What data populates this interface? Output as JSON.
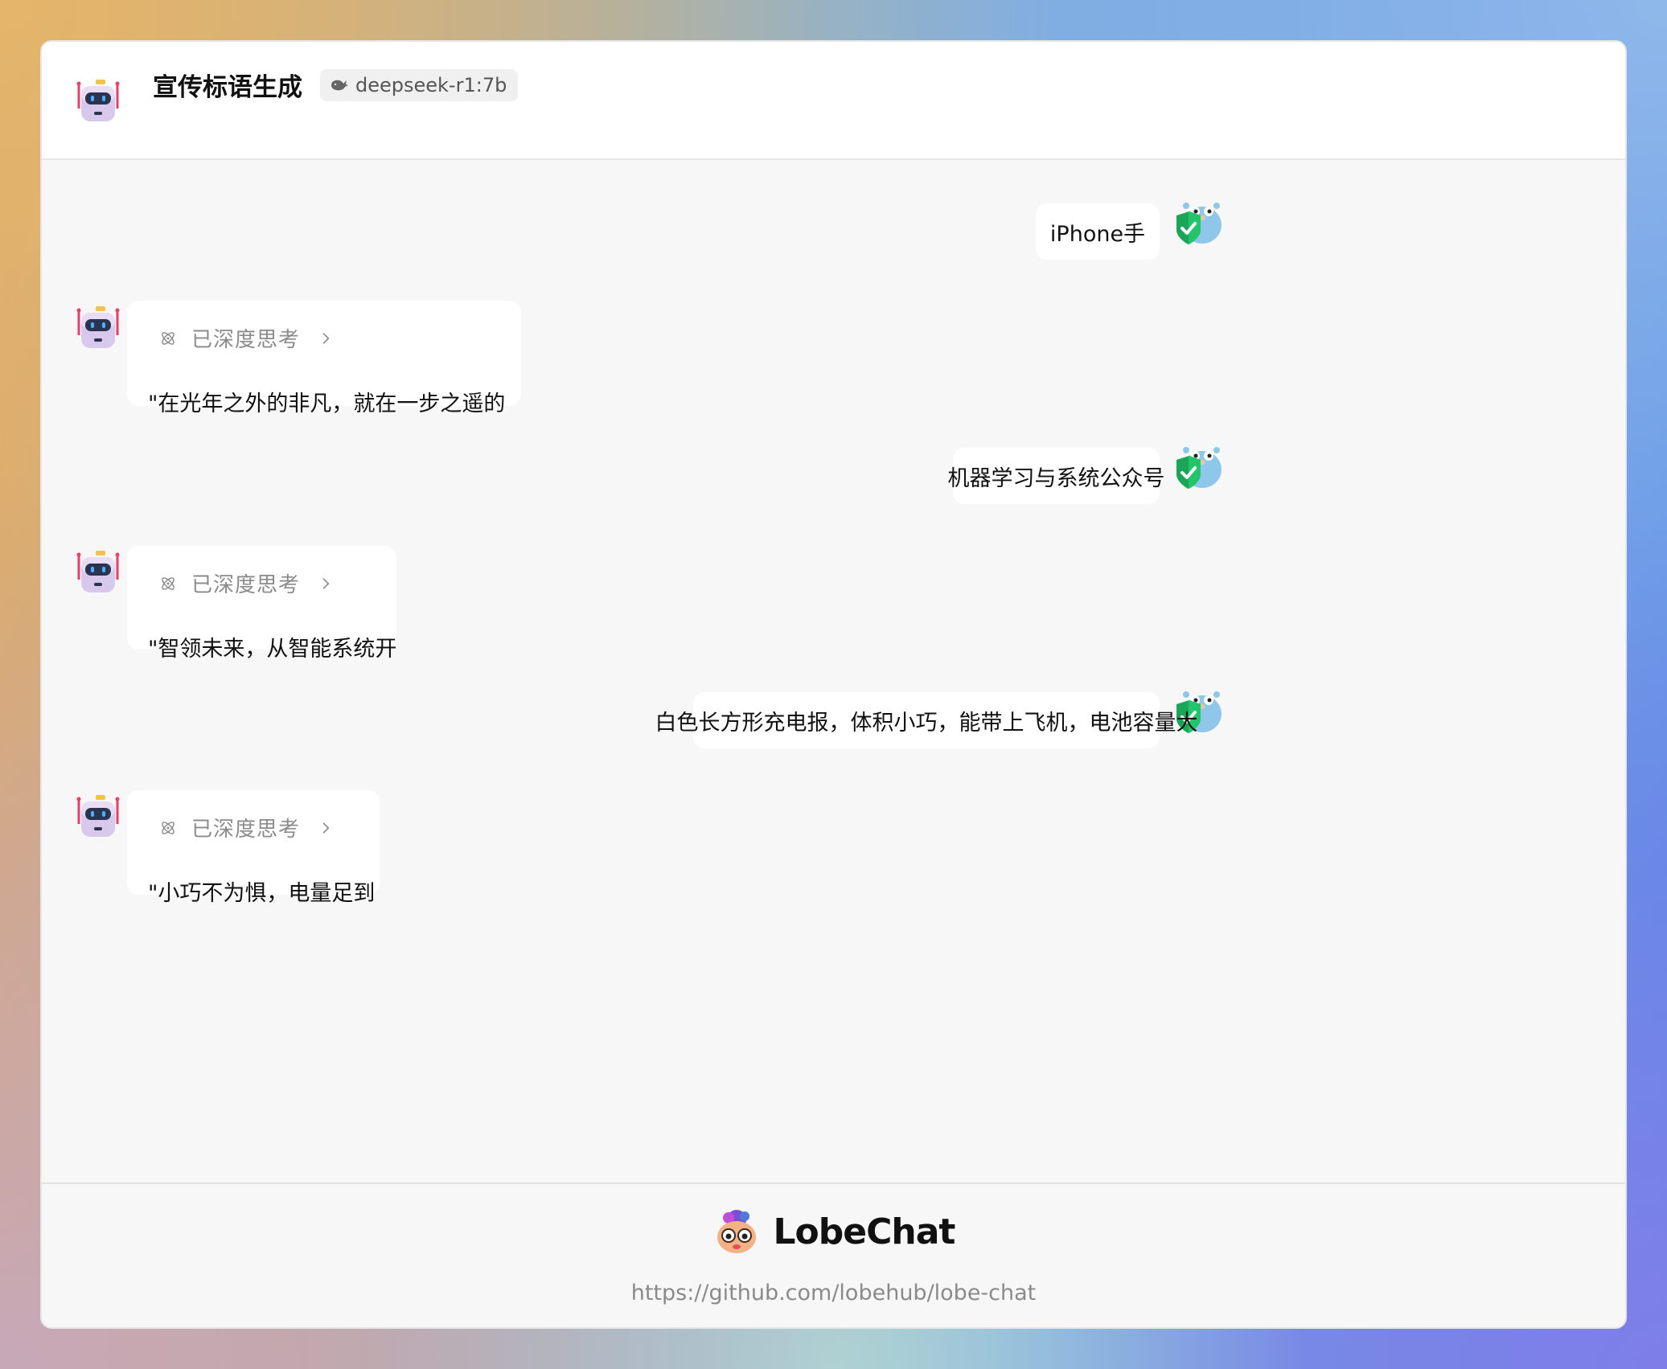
{
  "header": {
    "title": "宣传标语生成",
    "model": "deepseek-r1:7b"
  },
  "messages": [
    {
      "role": "user",
      "text": "iPhone手"
    },
    {
      "role": "assistant",
      "thinking_label": "已深度思考",
      "text": "\"在光年之外的非凡，就在一步之遥的"
    },
    {
      "role": "user",
      "text": "机器学习与系统公众号"
    },
    {
      "role": "assistant",
      "thinking_label": "已深度思考",
      "text": "\"智领未来，从智能系统开"
    },
    {
      "role": "user",
      "text": "白色长方形充电报，体积小巧，能带上飞机，电池容量大"
    },
    {
      "role": "assistant",
      "thinking_label": "已深度思考",
      "text": "\"小巧不为惧，电量足到"
    }
  ],
  "footer": {
    "brand": "LobeChat",
    "url": "https://github.com/lobehub/lobe-chat"
  },
  "icons": {
    "assistant_avatar": "robot-icon",
    "user_avatar": "gopher-shield-icon",
    "model": "whale-icon",
    "thinking": "atom-icon",
    "expand": "chevron-right-icon",
    "brand_logo": "lobe-icon"
  }
}
